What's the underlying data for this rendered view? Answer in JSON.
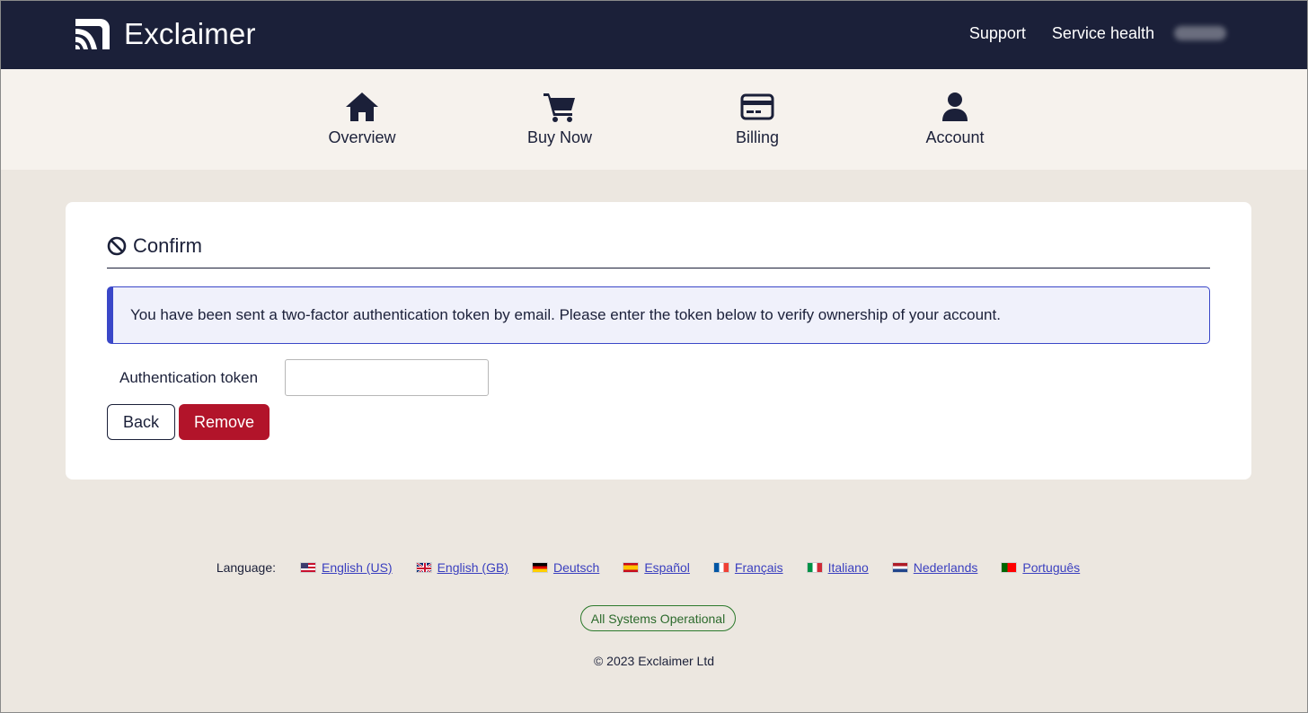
{
  "header": {
    "brand": "Exclaimer",
    "links": [
      "Support",
      "Service health"
    ]
  },
  "nav": {
    "items": [
      {
        "label": "Overview",
        "icon": "home-icon"
      },
      {
        "label": "Buy Now",
        "icon": "cart-icon"
      },
      {
        "label": "Billing",
        "icon": "credit-card-icon"
      },
      {
        "label": "Account",
        "icon": "user-icon"
      }
    ]
  },
  "card": {
    "title": "Confirm",
    "title_icon": "ban-icon",
    "alert": "You have been sent a two-factor authentication token by email. Please enter the token below to verify ownership of your account.",
    "token_label": "Authentication token",
    "token_value": "",
    "back_label": "Back",
    "remove_label": "Remove"
  },
  "footer": {
    "language_caption": "Language:",
    "languages": [
      {
        "label": "English (US)",
        "flag": "us-flag-icon"
      },
      {
        "label": "English (GB)",
        "flag": "gb-flag-icon"
      },
      {
        "label": "Deutsch",
        "flag": "de-flag-icon"
      },
      {
        "label": "Español",
        "flag": "es-flag-icon"
      },
      {
        "label": "Français",
        "flag": "fr-flag-icon"
      },
      {
        "label": "Italiano",
        "flag": "it-flag-icon"
      },
      {
        "label": "Nederlands",
        "flag": "nl-flag-icon"
      },
      {
        "label": "Português",
        "flag": "pt-flag-icon"
      }
    ],
    "status": "All Systems Operational",
    "copyright": "© 2023 Exclaimer Ltd"
  },
  "colors": {
    "header_bg": "#1b2039",
    "nav_bg": "#f6f2ed",
    "page_bg": "#ece7e0",
    "accent_blue": "#3a47c8",
    "remove_red": "#b2142a",
    "status_green": "#2c7a2c"
  }
}
